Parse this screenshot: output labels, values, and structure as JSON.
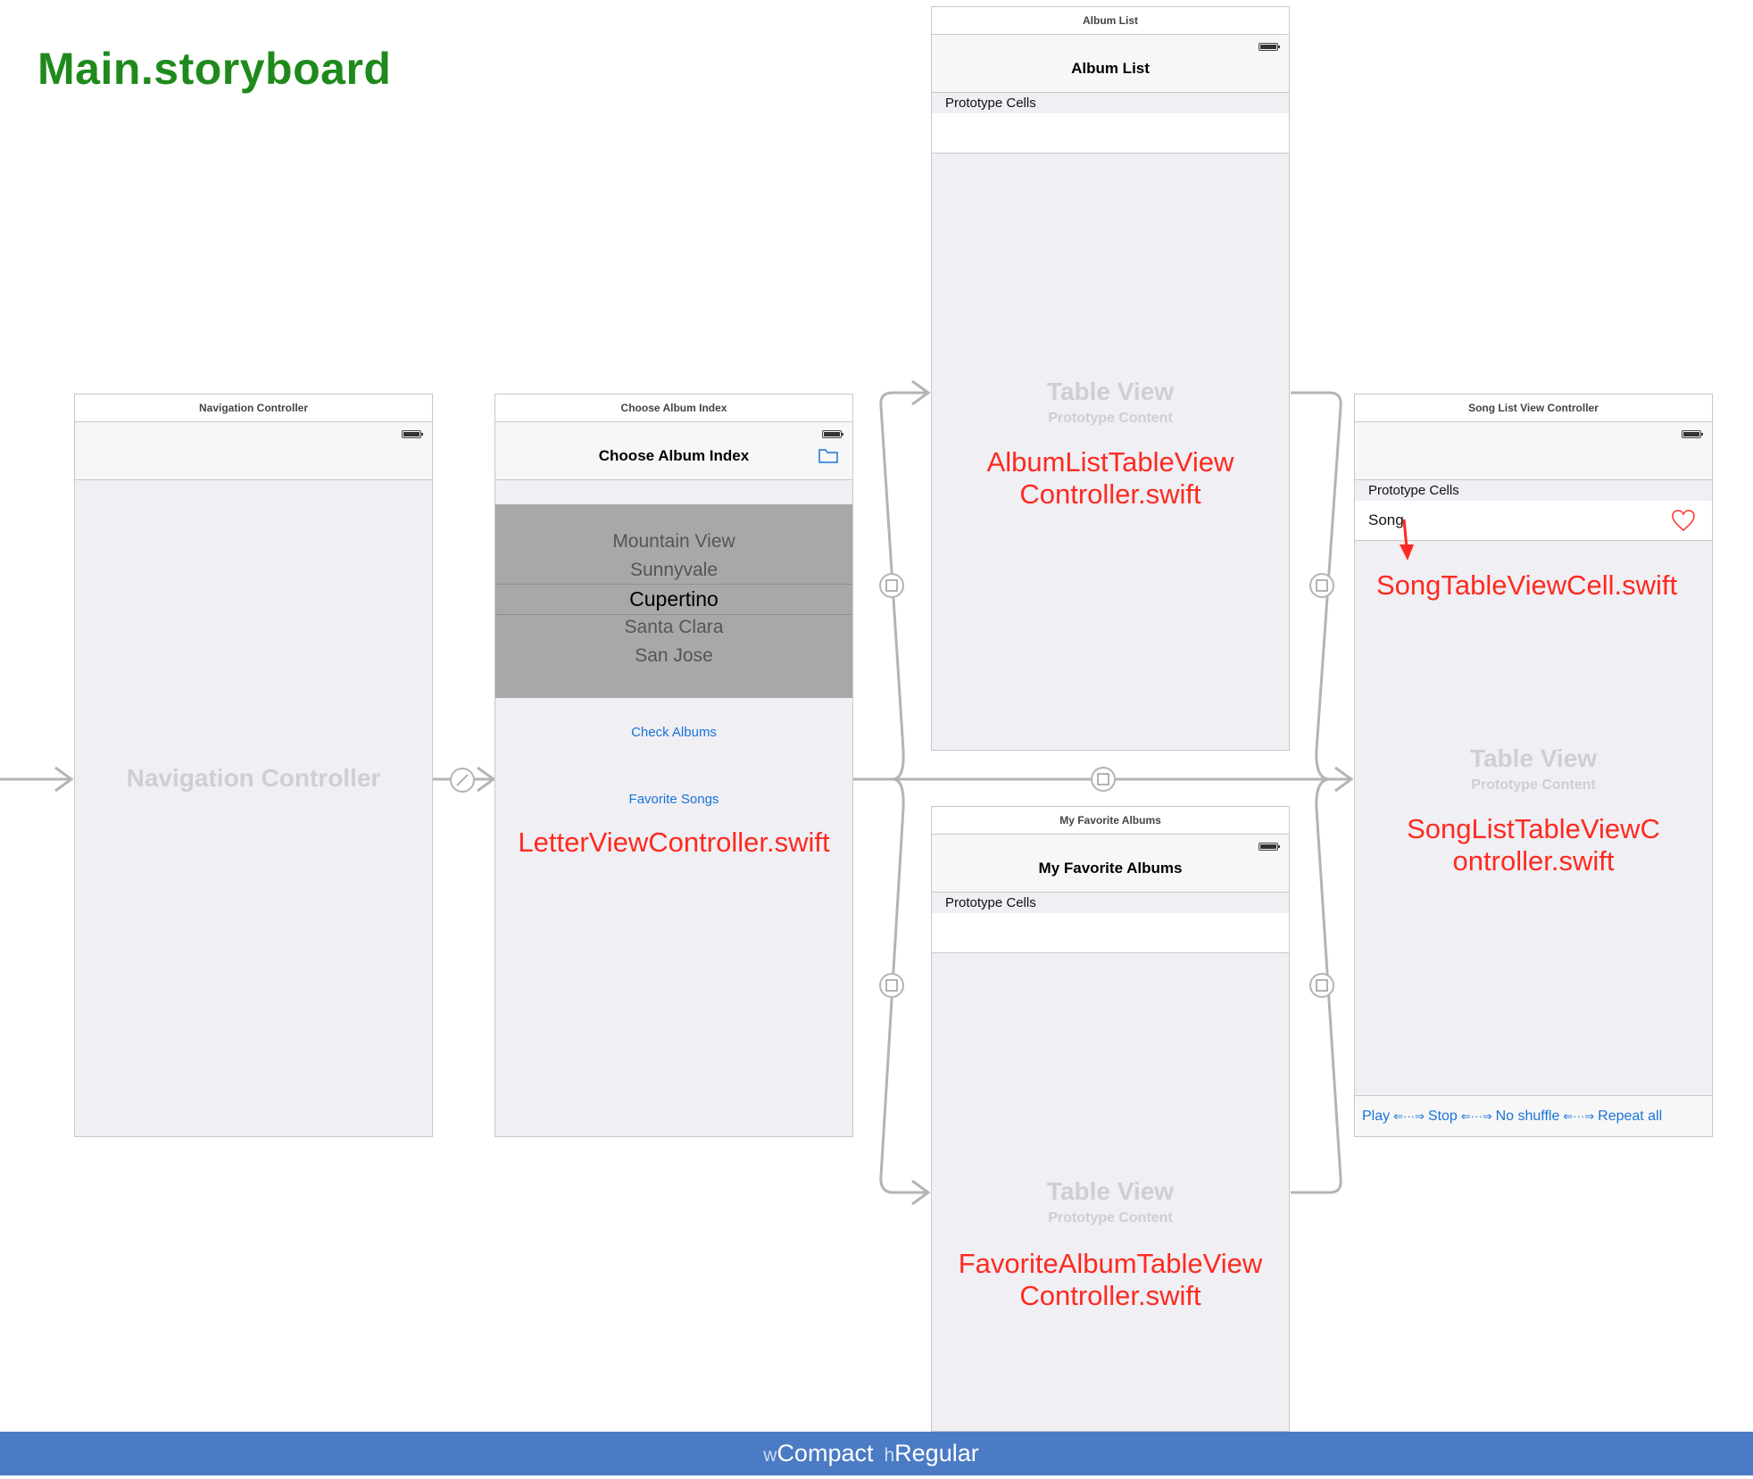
{
  "document_title": "Main.storyboard",
  "scenes": {
    "navigation": {
      "header": "Navigation Controller",
      "ghost_title": "Navigation Controller"
    },
    "choose_album": {
      "header": "Choose Album Index",
      "nav_title": "Choose Album Index",
      "picker_rows": [
        "Mountain View",
        "Sunnyvale",
        "Cupertino",
        "Santa Clara",
        "San Jose"
      ],
      "picker_selected": "Cupertino",
      "check_albums": "Check Albums",
      "favorite_songs": "Favorite Songs",
      "class_label": "LetterViewController.swift"
    },
    "album_list": {
      "header": "Album List",
      "nav_title": "Album List",
      "prototype_label": "Prototype Cells",
      "ghost_title": "Table View",
      "ghost_sub": "Prototype Content",
      "class_label_1": "AlbumListTableView",
      "class_label_2": "Controller.swift"
    },
    "favorite_albums": {
      "header": "My Favorite Albums",
      "nav_title": "My Favorite Albums",
      "prototype_label": "Prototype Cells",
      "ghost_title": "Table View",
      "ghost_sub": "Prototype Content",
      "class_label_1": "FavoriteAlbumTableView",
      "class_label_2": "Controller.swift"
    },
    "song_list": {
      "header": "Song List View Controller",
      "prototype_label": "Prototype Cells",
      "cell_label": "Song",
      "cell_class_label": "SongTableViewCell.swift",
      "ghost_title": "Table View",
      "ghost_sub": "Prototype Content",
      "class_label_1": "SongListTableViewC",
      "class_label_2": "ontroller.swift",
      "toolbar": [
        "Play",
        "Stop",
        "No shuffle",
        "Repeat all"
      ]
    }
  },
  "size_class": {
    "w_prefix": "w",
    "w_value": "Compact",
    "h_prefix": "h",
    "h_value": "Regular"
  },
  "colors": {
    "title_green": "#1f8a1c",
    "annotation_red": "#ff2a1f",
    "link_blue": "#1a73d9",
    "bottom_bar": "#4a7bc4"
  }
}
